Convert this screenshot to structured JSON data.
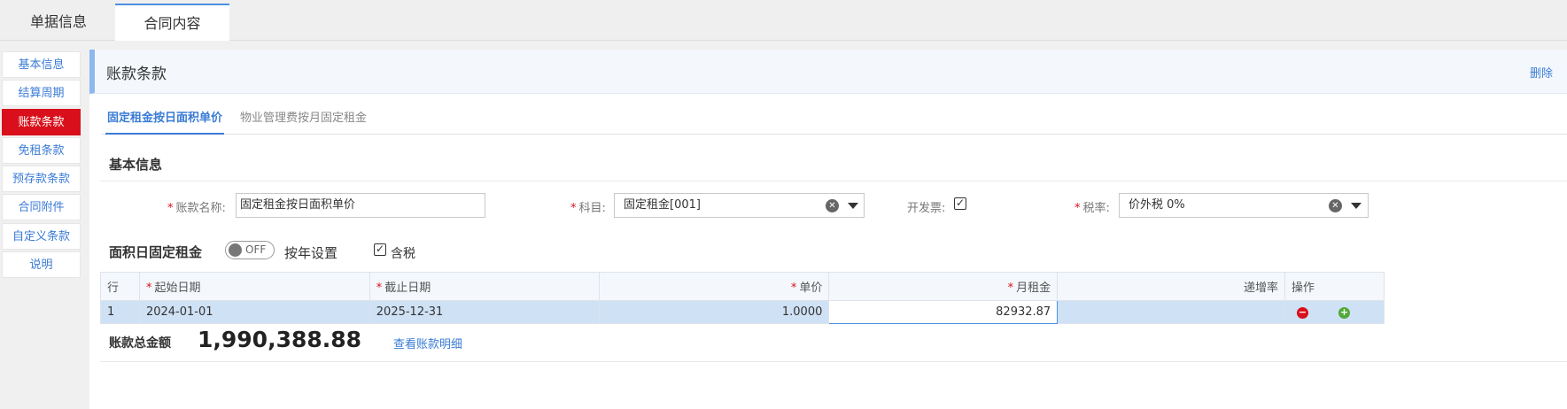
{
  "top_tabs": [
    {
      "label": "单据信息"
    },
    {
      "label": "合同内容"
    }
  ],
  "side_nav": {
    "items": [
      {
        "label": "基本信息"
      },
      {
        "label": "结算周期"
      },
      {
        "label": "账款条款"
      },
      {
        "label": "免租条款"
      },
      {
        "label": "预存款条款"
      },
      {
        "label": "合同附件"
      },
      {
        "label": "自定义条款"
      },
      {
        "label": "说明"
      }
    ],
    "active": "账款条款"
  },
  "section": {
    "title": "账款条款",
    "delete_label": "删除"
  },
  "sub_tabs": [
    {
      "label": "固定租金按日面积单价"
    },
    {
      "label": "物业管理费按月固定租金"
    }
  ],
  "basic_info": {
    "title": "基本信息",
    "required_mark": "*",
    "name_label": "账款名称:",
    "name_value": "固定租金按日面积单价",
    "subject_label": "科目:",
    "subject_value": "固定租金[001]",
    "invoice_label": "开发票:",
    "invoice_checked": true,
    "tax_label": "税率:",
    "tax_value": "价外税 0%"
  },
  "rent": {
    "title": "面积日固定租金",
    "toggle_text": "OFF",
    "yearly_label": "按年设置",
    "tax_included_label": "含税",
    "tax_included_checked": true
  },
  "table": {
    "headers": {
      "row": "行",
      "start": "起始日期",
      "end": "截止日期",
      "unit_price": "单价",
      "monthly_rent": "月租金",
      "increase_rate": "递增率",
      "actions": "操作"
    },
    "rows": [
      {
        "row": "1",
        "start": "2024-01-01",
        "end": "2025-12-31",
        "unit_price": "1.0000",
        "monthly_rent": "82932.87",
        "increase_rate": ""
      }
    ]
  },
  "summary": {
    "total_label": "账款总金额",
    "total_value": "1,990,388.88",
    "detail_link": "查看账款明细"
  },
  "colors": {
    "accent": "#3a7bd5",
    "active_nav": "#d9101b",
    "selected_row": "#cfe1f5",
    "header_bg": "#f4f8fd"
  }
}
